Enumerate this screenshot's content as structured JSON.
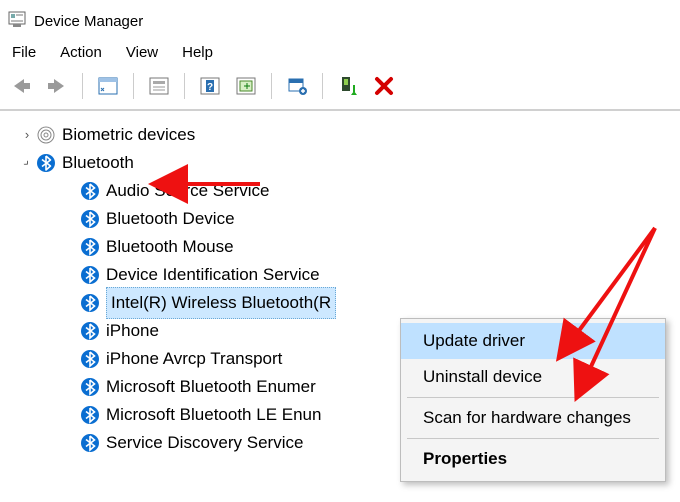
{
  "window": {
    "title": "Device Manager"
  },
  "menu": {
    "file": "File",
    "action": "Action",
    "view": "View",
    "help": "Help"
  },
  "tree": {
    "biometric": {
      "label": "Biometric devices"
    },
    "bluetooth": {
      "label": "Bluetooth",
      "items": [
        "Audio Source Service",
        "Bluetooth Device",
        "Bluetooth Mouse",
        "Device Identification Service",
        "Intel(R) Wireless Bluetooth(R",
        "iPhone",
        "iPhone Avrcp Transport",
        "Microsoft Bluetooth Enumer",
        "Microsoft Bluetooth LE Enun",
        "Service Discovery Service"
      ]
    }
  },
  "context_menu": {
    "update": "Update driver",
    "uninstall": "Uninstall device",
    "scan": "Scan for hardware changes",
    "properties": "Properties"
  }
}
